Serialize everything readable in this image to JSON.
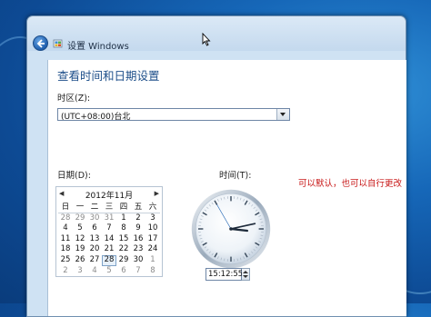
{
  "window": {
    "title": "设置 Windows"
  },
  "page": {
    "heading": "查看时间和日期设置",
    "timezone_label": "时区(Z):",
    "timezone_value": "(UTC+08:00)台北",
    "date_label": "日期(D):",
    "time_label": "时间(T):",
    "time_value": "15:12:55"
  },
  "calendar": {
    "month_title": "2012年11月",
    "prev_symbol": "◀",
    "next_symbol": "▶",
    "weekdays": [
      "日",
      "一",
      "二",
      "三",
      "四",
      "五",
      "六"
    ],
    "weeks": [
      [
        "28",
        "29",
        "30",
        "31",
        "1",
        "2",
        "3"
      ],
      [
        "4",
        "5",
        "6",
        "7",
        "8",
        "9",
        "10"
      ],
      [
        "11",
        "12",
        "13",
        "14",
        "15",
        "16",
        "17"
      ],
      [
        "18",
        "19",
        "20",
        "21",
        "22",
        "23",
        "24"
      ],
      [
        "25",
        "26",
        "27",
        "28",
        "29",
        "30",
        "1"
      ],
      [
        "2",
        "3",
        "4",
        "5",
        "6",
        "7",
        "8"
      ]
    ],
    "selected_day": "28"
  },
  "clock": {
    "hours": 15,
    "minutes": 12,
    "seconds": 55
  },
  "annotation": "可以默认，也可以自行更改",
  "icons": {
    "back": "back-arrow-icon",
    "setup": "windows-setup-icon",
    "cursor": "mouse-pointer-icon"
  },
  "colors": {
    "heading": "#1e4f8a",
    "annotation": "#c81818",
    "desktop": "#1667b8"
  }
}
